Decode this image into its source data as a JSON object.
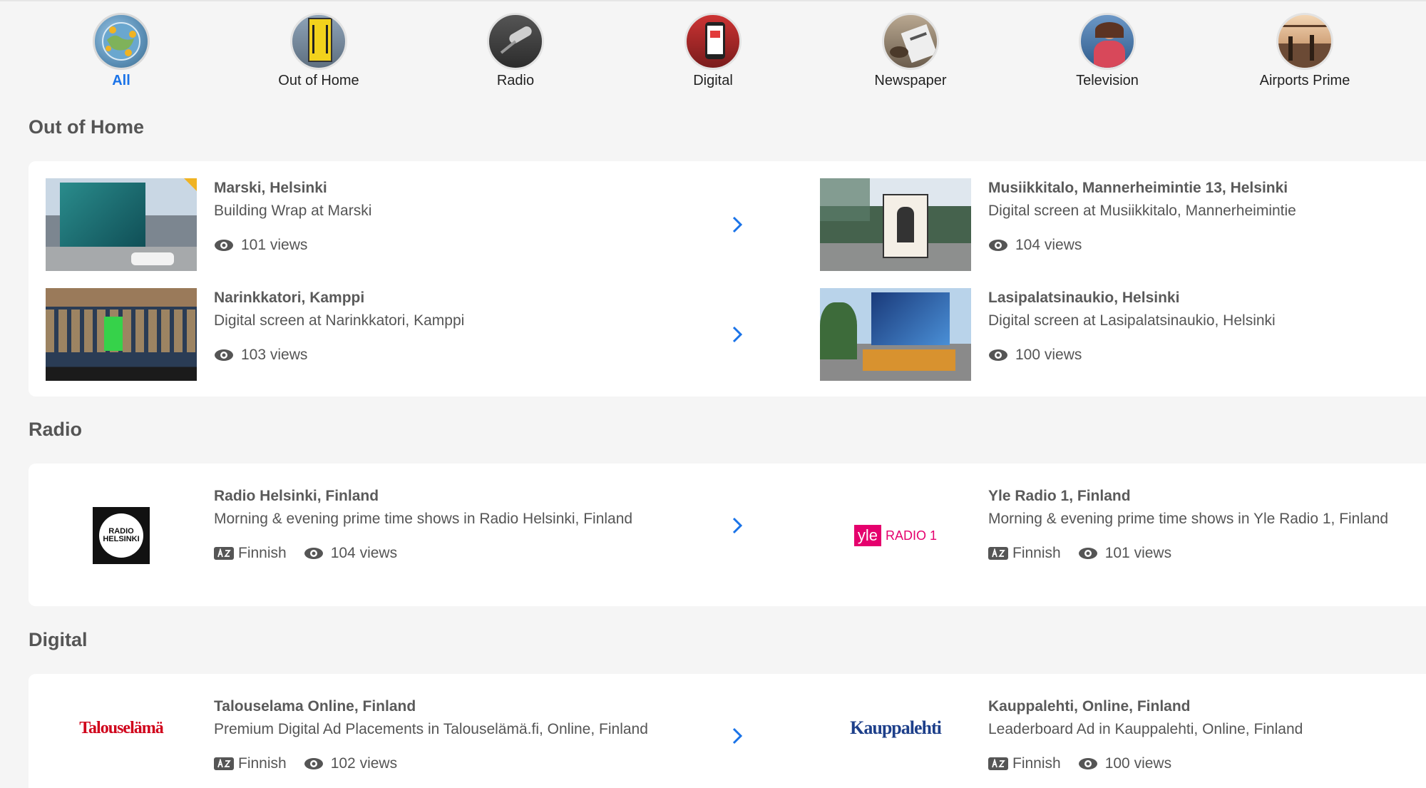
{
  "categories": [
    {
      "label": "All",
      "icon": "globe-icon",
      "active": true
    },
    {
      "label": "Out of Home",
      "icon": "billboard-icon",
      "active": false
    },
    {
      "label": "Radio",
      "icon": "microphone-icon",
      "active": false
    },
    {
      "label": "Digital",
      "icon": "phone-icon",
      "active": false
    },
    {
      "label": "Newspaper",
      "icon": "newspaper-icon",
      "active": false
    },
    {
      "label": "Television",
      "icon": "television-icon",
      "active": false
    },
    {
      "label": "Airports Prime",
      "icon": "airport-icon",
      "active": false
    }
  ],
  "sections": {
    "ooh": {
      "title": "Out of Home",
      "items": [
        {
          "title": "Marski, Helsinki",
          "desc": "Building Wrap at Marski",
          "views": "101 views"
        },
        {
          "title": "Musiikkitalo, Mannerheimintie 13, Helsinki",
          "desc": "Digital screen at Musiikkitalo, Mannerheimintie",
          "views": "104 views"
        },
        {
          "title": "Narinkkatori, Kamppi",
          "desc": "Digital screen at Narinkkatori, Kamppi",
          "views": "103 views"
        },
        {
          "title": "Lasipalatsinaukio, Helsinki",
          "desc": "Digital screen at Lasipalatsinaukio, Helsinki",
          "views": "100 views"
        }
      ]
    },
    "radio": {
      "title": "Radio",
      "items": [
        {
          "title": "Radio Helsinki, Finland",
          "desc": "Morning & evening prime time shows in Radio Helsinki, Finland",
          "language": "Finnish",
          "views": "104 views",
          "logo_text": "RADIO HELSINKI"
        },
        {
          "title": "Yle Radio 1, Finland",
          "desc": "Morning & evening prime time shows in Yle Radio 1, Finland",
          "language": "Finnish",
          "views": "101 views",
          "logo_text_a": "yle",
          "logo_text_b": "RADIO 1"
        }
      ]
    },
    "digital": {
      "title": "Digital",
      "items": [
        {
          "title": "Talouselama Online, Finland",
          "desc": "Premium Digital Ad Placements in Talouselämä.fi, Online, Finland",
          "language": "Finnish",
          "views": "102 views",
          "logo_text": "Talouselämä"
        },
        {
          "title": "Kauppalehti, Online, Finland",
          "desc": "Leaderboard Ad in Kauppalehti, Online, Finland",
          "language": "Finnish",
          "views": "100 views",
          "logo_text": "Kauppalehti"
        }
      ]
    }
  },
  "colors": {
    "accent": "#1a73e8",
    "yle_pink": "#e5006d",
    "talouselama_red": "#d0021b",
    "kauppalehti_blue": "#1d3f8a"
  }
}
